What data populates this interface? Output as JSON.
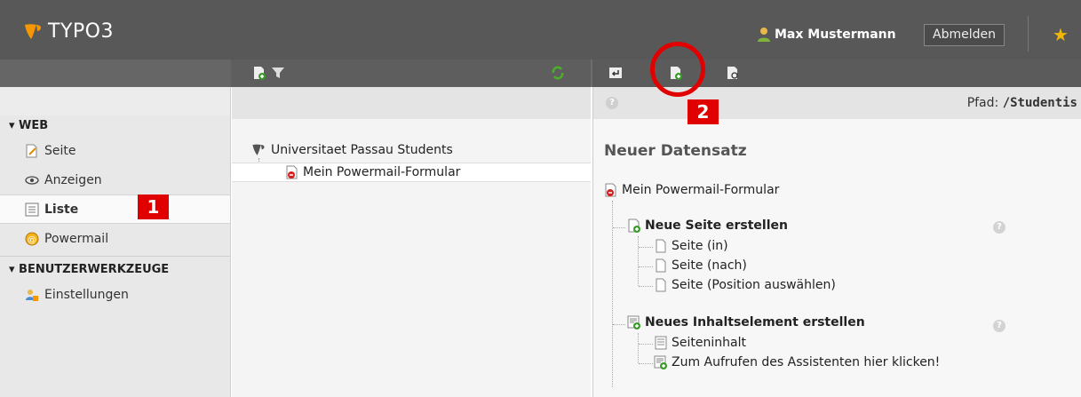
{
  "topbar": {
    "logo_text": "TYPO3",
    "user_name": "Max Mustermann",
    "logout_label": "Abmelden",
    "bookmark_icon": "star-icon",
    "colors": {
      "bar": "#585858",
      "accent": "#f49700",
      "star": "#f2b705"
    }
  },
  "module_menu": {
    "groups": [
      {
        "title": "▾ WEB",
        "items": [
          {
            "label": "Seite",
            "icon": "page-edit-icon"
          },
          {
            "label": "Anzeigen",
            "icon": "eye-icon"
          },
          {
            "label": "Liste",
            "icon": "list-icon",
            "active": true
          },
          {
            "label": "Powermail",
            "icon": "powermail-icon"
          }
        ]
      },
      {
        "title": "▾ BENUTZERWERKZEUGE",
        "items": [
          {
            "label": "Einstellungen",
            "icon": "user-settings-icon"
          }
        ]
      }
    ]
  },
  "page_tree": {
    "root_label": "Universitaet Passau Students",
    "node_label": "Mein Powermail-Formular"
  },
  "content": {
    "path_label": "Pfad:",
    "path_value": "/Studentis",
    "heading": "Neuer Datensatz",
    "record_title": "Mein Powermail-Formular",
    "section_page": {
      "title": "Neue Seite erstellen",
      "items": [
        "Seite (in)",
        "Seite (nach)",
        "Seite (Position auswählen)"
      ]
    },
    "section_content": {
      "title": "Neues Inhaltselement erstellen",
      "items": [
        "Seiteninhalt",
        "Zum Aufrufen des Assistenten hier klicken!"
      ]
    }
  },
  "annotations": {
    "badge_1": "1",
    "badge_2": "2",
    "color": "#e10000"
  }
}
